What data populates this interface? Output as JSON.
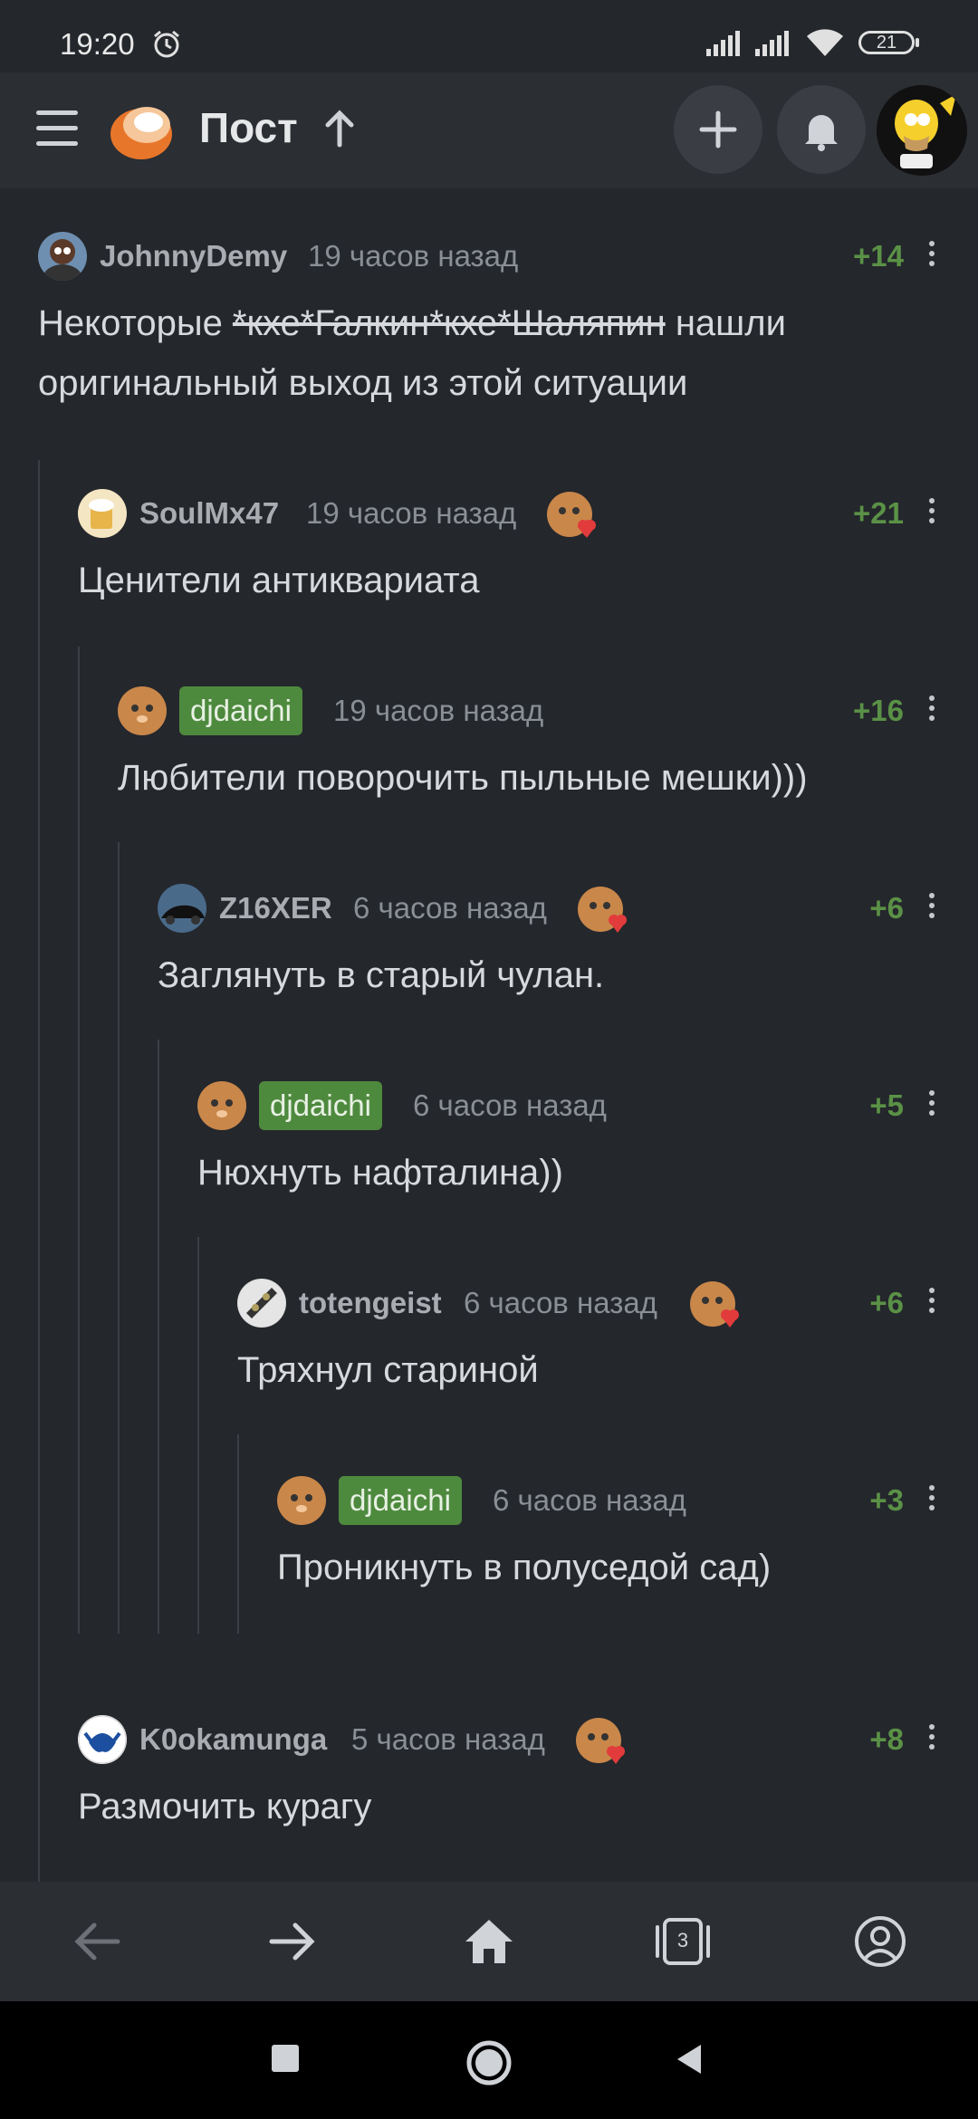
{
  "status_bar": {
    "time": "19:20",
    "battery": "21"
  },
  "header": {
    "title": "Пост"
  },
  "comments": [
    {
      "author": "JohnnyDemy",
      "time": "19 часов назад",
      "rating": "+14",
      "text_strike": "*кхе*Галкин*кхе*Шаляпин",
      "text_before": "Некоторые ",
      "text_after": " нашли",
      "text_line2": "оригинальный выход из этой ситуации"
    },
    {
      "author": "SoulMx47",
      "time": "19 часов назад",
      "rating": "+21",
      "text": "Ценители антиквариата"
    },
    {
      "author": "djdaichi",
      "time": "19 часов назад",
      "rating": "+16",
      "text": "Любители поворочить пыльные мешки)))"
    },
    {
      "author": "Z16XER",
      "time": "6 часов назад",
      "rating": "+6",
      "text": "Заглянуть в старый чулан."
    },
    {
      "author": "djdaichi",
      "time": "6 часов назад",
      "rating": "+5",
      "text": "Нюхнуть нафталина))"
    },
    {
      "author": "totengeist",
      "time": "6 часов назад",
      "rating": "+6",
      "text": "Тряхнул стариной"
    },
    {
      "author": "djdaichi",
      "time": "6 часов назад",
      "rating": "+3",
      "text": "Проникнуть в полуседой сад)"
    },
    {
      "author": "K0okamunga",
      "time": "5 часов назад",
      "rating": "+8",
      "text": "Размочить курагу"
    }
  ],
  "bottom_nav": {
    "tabs_count": "3"
  },
  "icons": [
    "menu-icon",
    "pikabu-logo-icon",
    "arrow-up-icon",
    "plus-icon",
    "bell-icon",
    "more-vertical-icon",
    "back-icon",
    "forward-icon",
    "home-icon",
    "tabs-icon",
    "account-icon"
  ],
  "colors": {
    "background": "#24272c",
    "header": "#2b2e33",
    "rating": "#5a9146",
    "badge": "#4e8a3e"
  }
}
